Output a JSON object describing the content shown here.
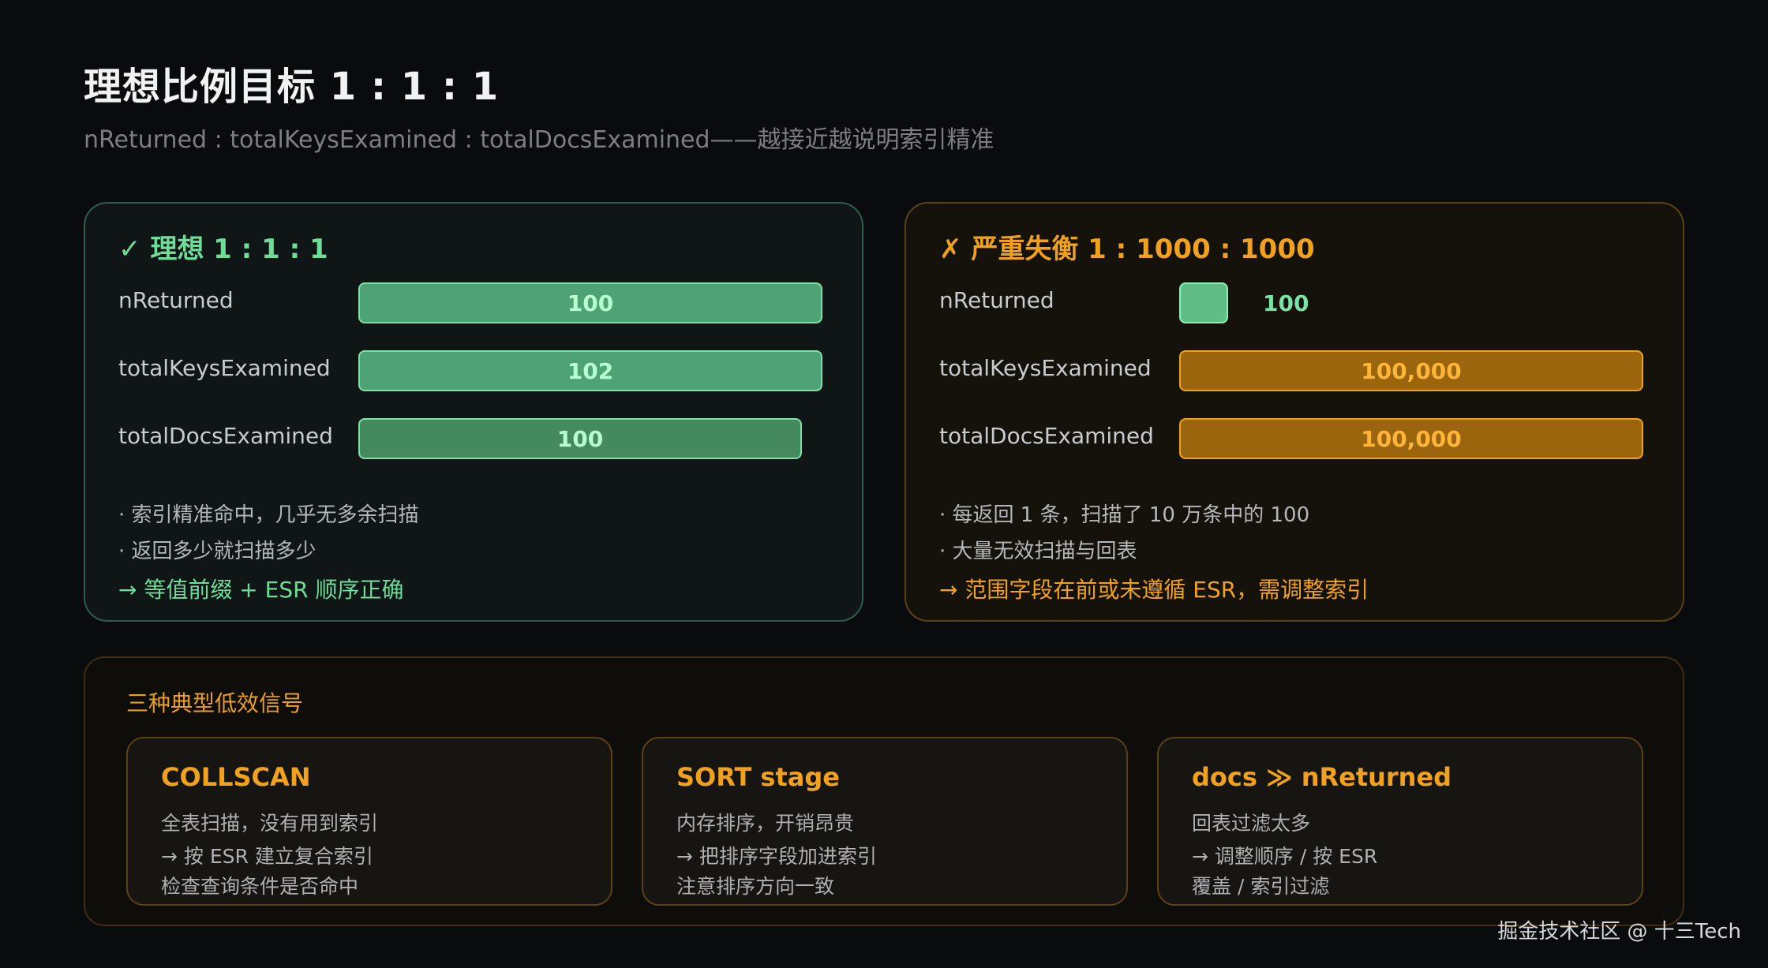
{
  "header": {
    "title": "理想比例目标 1 : 1 : 1",
    "subtitle": "nReturned : totalKeysExamined : totalDocsExamined——越接近越说明索引精准"
  },
  "good_panel": {
    "icon": "✓",
    "title": "理想 1 : 1 : 1",
    "metrics": [
      {
        "label": "nReturned",
        "value": "100",
        "fraction": 1.0
      },
      {
        "label": "totalKeysExamined",
        "value": "102",
        "fraction": 1.0
      },
      {
        "label": "totalDocsExamined",
        "value": "100",
        "fraction": 0.955
      }
    ],
    "notes": [
      "· 索引精准命中，几乎无多余扫描",
      "· 返回多少就扫描多少"
    ],
    "conclusion": "→ 等值前缀 + ESR 顺序正确"
  },
  "bad_panel": {
    "icon": "✗",
    "title": "严重失衡 1 : 1000 : 1000",
    "metrics": [
      {
        "label": "nReturned",
        "value": "100",
        "fraction": 0.001
      },
      {
        "label": "totalKeysExamined",
        "value": "100,000",
        "fraction": 1.0
      },
      {
        "label": "totalDocsExamined",
        "value": "100,000",
        "fraction": 1.0
      }
    ],
    "notes": [
      "· 每返回 1 条，扫描了 10 万条中的 100",
      "· 大量无效扫描与回表"
    ],
    "conclusion": "→ 范围字段在前或未遵循 ESR，需调整索引"
  },
  "bottom": {
    "title": "三种典型低效信号",
    "cards": [
      {
        "title": "COLLSCAN",
        "lines": [
          "全表扫描，没有用到索引",
          "→ 按 ESR 建立复合索引",
          "检查查询条件是否命中"
        ]
      },
      {
        "title": "SORT stage",
        "lines": [
          "内存排序，开销昂贵",
          "→ 把排序字段加进索引",
          "注意排序方向一致"
        ]
      },
      {
        "title": "docs ≫ nReturned",
        "lines": [
          "回表过滤太多",
          "→ 调整顺序 / 按 ESR",
          "覆盖 / 索引过滤"
        ]
      }
    ]
  },
  "watermark": "掘金技术社区 @ 十三Tech",
  "colors": {
    "good": "#6fdc9a",
    "bad": "#f0a21e",
    "background": "#0a0b0c"
  }
}
